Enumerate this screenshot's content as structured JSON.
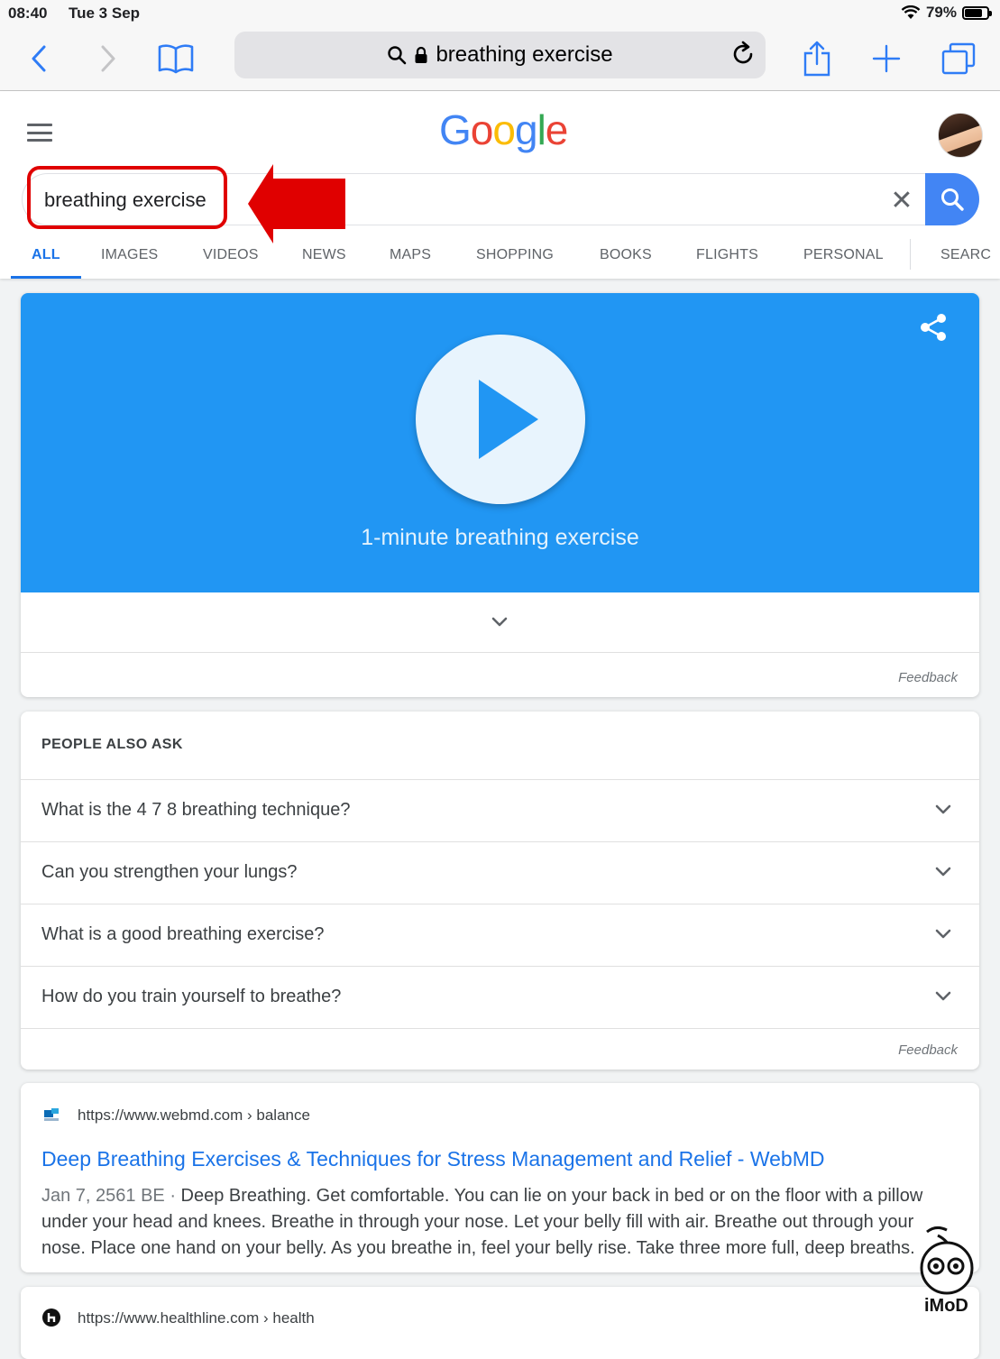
{
  "status_bar": {
    "time": "08:40",
    "date": "Tue 3 Sep",
    "battery": "79%",
    "battery_level": 0.79
  },
  "safari": {
    "url_text": "breathing exercise"
  },
  "google": {
    "logo_letters": [
      {
        "char": "G",
        "color": "#4285f4"
      },
      {
        "char": "o",
        "color": "#ea4335"
      },
      {
        "char": "o",
        "color": "#fbbc05"
      },
      {
        "char": "g",
        "color": "#4285f4"
      },
      {
        "char": "l",
        "color": "#34a853"
      },
      {
        "char": "e",
        "color": "#ea4335"
      }
    ],
    "search_value": "breathing exercise",
    "clear_symbol": "✕",
    "tabs": [
      "ALL",
      "IMAGES",
      "VIDEOS",
      "NEWS",
      "MAPS",
      "SHOPPING",
      "BOOKS",
      "FLIGHTS",
      "PERSONAL",
      "SEARC"
    ]
  },
  "player_card": {
    "label": "1-minute breathing exercise",
    "feedback": "Feedback"
  },
  "paa": {
    "title": "PEOPLE ALSO ASK",
    "questions": [
      "What is the 4 7 8 breathing technique?",
      "Can you strengthen your lungs?",
      "What is a good breathing exercise?",
      "How do you train yourself to breathe?"
    ],
    "feedback": "Feedback"
  },
  "results": [
    {
      "url": "https://www.webmd.com › balance",
      "title": "Deep Breathing Exercises & Techniques for Stress Management and Relief - WebMD",
      "date": "Jan 7, 2561 BE · ",
      "snippet": "Deep Breathing. Get comfortable. You can lie on your back in bed or on the floor with a pillow under your head and knees. Breathe in through your nose. Let your belly fill with air. Breathe out through your nose. Place one hand on your belly. As you breathe in, feel your belly rise. Take three more full, deep breaths."
    },
    {
      "url": "https://www.healthline.com › health"
    }
  ],
  "watermark": {
    "text": "iMoD"
  },
  "colors": {
    "accent": "#1a73e8",
    "player_blue": "#2196f3",
    "annotation_red": "#e00000"
  }
}
